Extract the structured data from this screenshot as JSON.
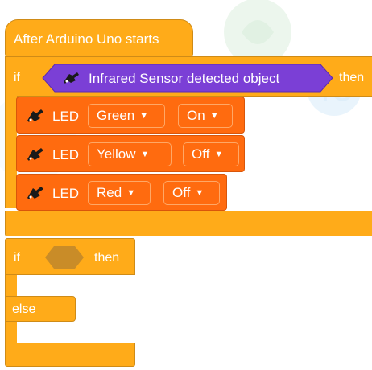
{
  "colors": {
    "control": "#FFAB19",
    "led": "#FF6B0F",
    "sensor": "#7B3FD6",
    "slot": "#C98C28"
  },
  "hat_block": {
    "label": "After Arduino Uno starts"
  },
  "if_block_1": {
    "if_label": "if",
    "then_label": "then",
    "condition": {
      "icon": "arduino-sensor-icon",
      "label": "Infrared Sensor detected object"
    }
  },
  "led_blocks": [
    {
      "icon": "led-module-icon",
      "label": "LED",
      "color": "Green",
      "state": "On"
    },
    {
      "icon": "led-module-icon",
      "label": "LED",
      "color": "Yellow",
      "state": "Off"
    },
    {
      "icon": "led-module-icon",
      "label": "LED",
      "color": "Red",
      "state": "Off"
    }
  ],
  "if_else_block": {
    "if_label": "if",
    "then_label": "then",
    "else_label": "else"
  }
}
